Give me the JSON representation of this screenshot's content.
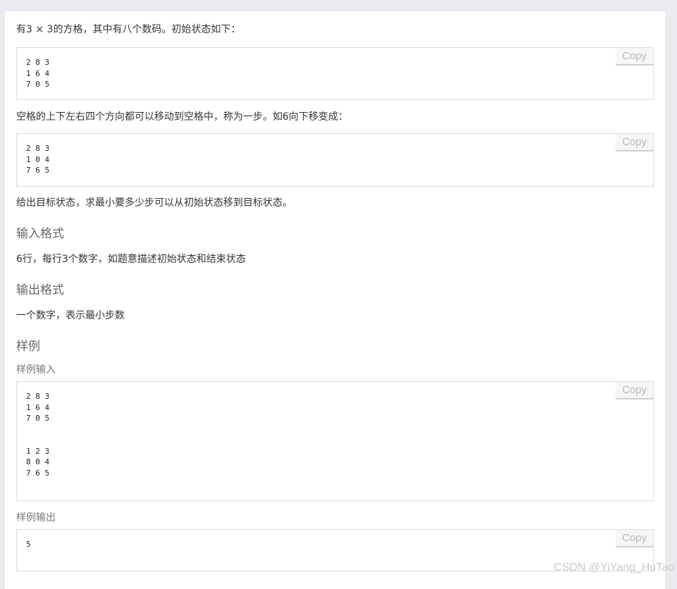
{
  "problem": {
    "intro": "有3 × 3的方格，其中有八个数码。初始状态如下：",
    "initial_state": "2 8 3\n1 6 4\n7 0 5",
    "move_rule": "空格的上下左右四个方向都可以移动到空格中，称为一步。如6向下移变成：",
    "moved_state": "2 8 3\n1 0 4\n7 6 5",
    "goal": "给出目标状态，求最小要多少步可以从初始状态移到目标状态。"
  },
  "input_format": {
    "heading": "输入格式",
    "text": "6行，每行3个数字，如题意描述初始状态和结束状态"
  },
  "output_format": {
    "heading": "输出格式",
    "text": "一个数字，表示最小步数"
  },
  "samples": {
    "heading": "样例",
    "input_label": "样例输入",
    "input": "2 8 3\n1 6 4\n7 0 5\n\n\n1 2 3\n8 0 4\n7 6 5",
    "output_label": "样例输出",
    "output": "5"
  },
  "copy_label": "Copy",
  "watermark": "CSDN @YiYang_HuTao"
}
